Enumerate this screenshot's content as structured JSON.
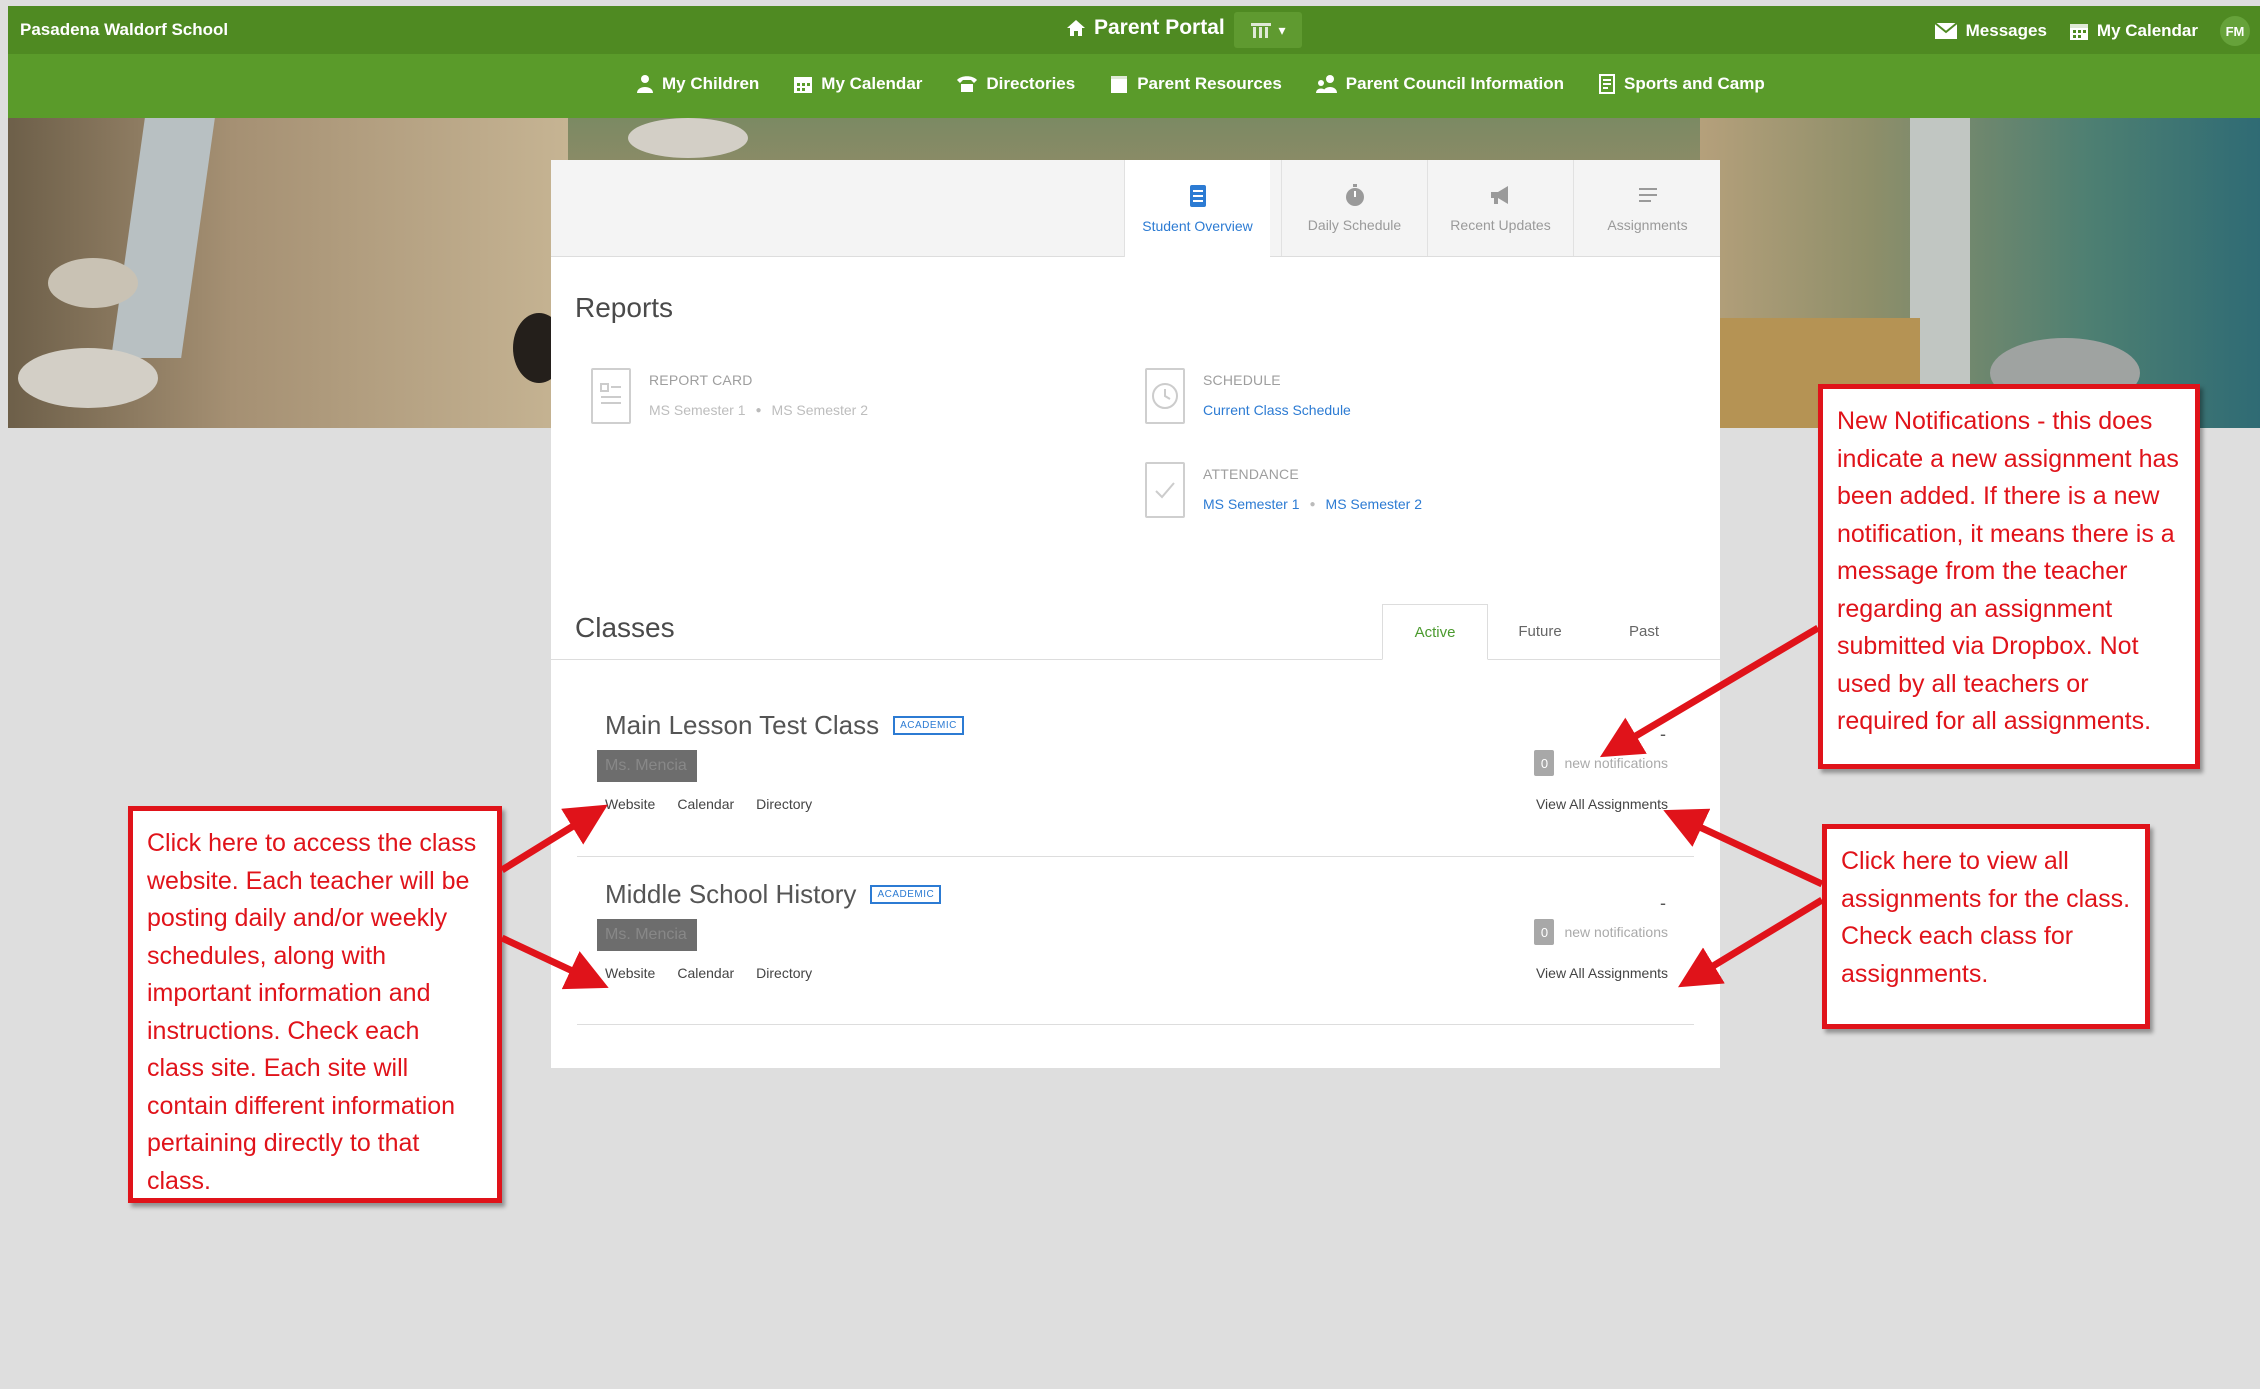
{
  "topbar": {
    "school_name": "Pasadena Waldorf School",
    "portal_label": "Parent Portal",
    "messages_label": "Messages",
    "my_calendar_label": "My Calendar",
    "avatar_initials": "FM"
  },
  "nav": {
    "items": [
      {
        "label": "My Children",
        "icon": "person-icon"
      },
      {
        "label": "My Calendar",
        "icon": "calendar-icon"
      },
      {
        "label": "Directories",
        "icon": "phone-icon"
      },
      {
        "label": "Parent Resources",
        "icon": "folder-icon"
      },
      {
        "label": "Parent Council Information",
        "icon": "people-icon"
      },
      {
        "label": "Sports and Camp",
        "icon": "document-icon"
      }
    ]
  },
  "tabs": [
    {
      "label": "Student Overview",
      "active": true
    },
    {
      "label": "Daily Schedule",
      "active": false
    },
    {
      "label": "Recent Updates",
      "active": false
    },
    {
      "label": "Assignments",
      "active": false
    }
  ],
  "reports": {
    "title": "Reports",
    "report_card": {
      "label": "REPORT CARD",
      "links": [
        "MS Semester 1",
        "MS Semester 2"
      ]
    },
    "schedule": {
      "label": "SCHEDULE",
      "link": "Current Class Schedule"
    },
    "attendance": {
      "label": "ATTENDANCE",
      "links": [
        "MS Semester 1",
        "MS Semester 2"
      ]
    }
  },
  "classes": {
    "title": "Classes",
    "tabs": [
      "Active",
      "Future",
      "Past"
    ],
    "rows": [
      {
        "name": "Main Lesson Test Class",
        "badge": "ACADEMIC",
        "teacher": "Ms. Mencia",
        "links": [
          "Website",
          "Calendar",
          "Directory"
        ],
        "notif_count": "0",
        "notif_label": "new notifications",
        "view_all": "View All Assignments",
        "dash": "-"
      },
      {
        "name": "Middle School History",
        "badge": "ACADEMIC",
        "teacher": "Ms. Mencia",
        "links": [
          "Website",
          "Calendar",
          "Directory"
        ],
        "notif_count": "0",
        "notif_label": "new notifications",
        "view_all": "View All Assignments",
        "dash": "-"
      }
    ]
  },
  "callouts": {
    "notifications": "New Notifications - this does indicate a new assignment has been added. If there is a new notification, it means there is a message from the teacher regarding an assignment submitted via Dropbox. Not used by all teachers or required for all assignments.",
    "website": "Click here to access the class website. Each teacher will be posting daily and/or weekly schedules, along with important information and instructions. Check each class site. Each site will contain different information pertaining directly to that class.",
    "assignments": "Click here to view all assignments for the class. Check each class for assignments."
  },
  "colors": {
    "topbar": "#4f8a22",
    "navbar": "#5a9b2a",
    "link_blue": "#2c7bd3",
    "callout_red": "#e0131a",
    "active_green": "#4b9a2e"
  }
}
